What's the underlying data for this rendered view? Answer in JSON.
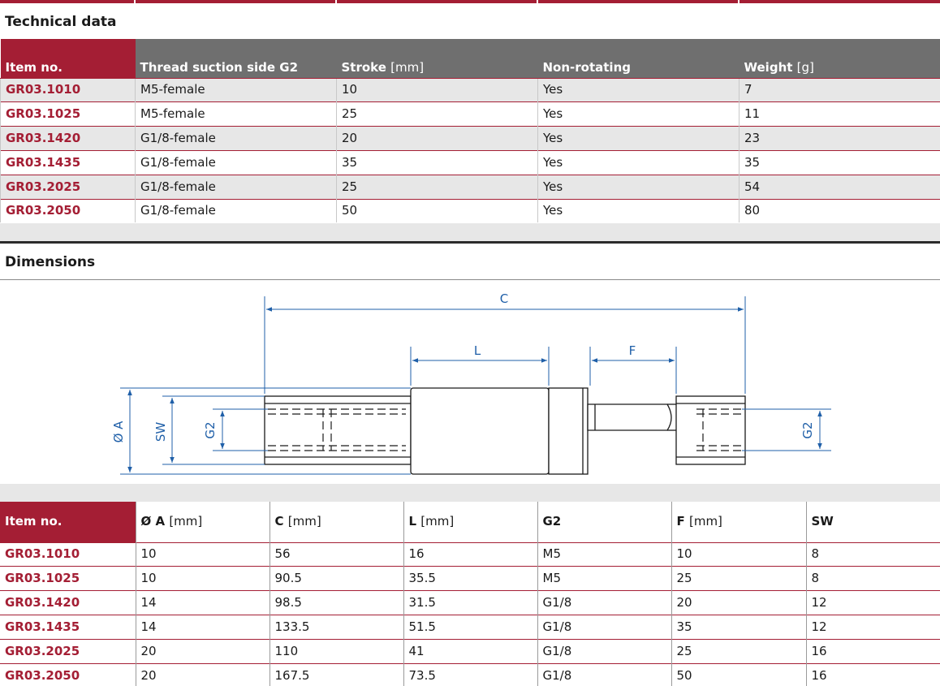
{
  "technical": {
    "title": "Technical data",
    "headers": [
      {
        "label": "Item no.",
        "unit": ""
      },
      {
        "label": "Thread suction side G2",
        "unit": ""
      },
      {
        "label": "Stroke",
        "unit": "[mm]"
      },
      {
        "label": "Non-rotating",
        "unit": ""
      },
      {
        "label": "Weight",
        "unit": "[g]"
      }
    ],
    "rows": [
      [
        "GR03.1010",
        "M5-female",
        "10",
        "Yes",
        "7"
      ],
      [
        "GR03.1025",
        "M5-female",
        "25",
        "Yes",
        "11"
      ],
      [
        "GR03.1420",
        "G1/8-female",
        "20",
        "Yes",
        "23"
      ],
      [
        "GR03.1435",
        "G1/8-female",
        "35",
        "Yes",
        "35"
      ],
      [
        "GR03.2025",
        "G1/8-female",
        "25",
        "Yes",
        "54"
      ],
      [
        "GR03.2050",
        "G1/8-female",
        "50",
        "Yes",
        "80"
      ]
    ]
  },
  "dimensions": {
    "title": "Dimensions",
    "drawing_labels": {
      "c": "C",
      "l": "L",
      "f": "F",
      "a": "Ø A",
      "sw": "SW",
      "g2_left": "G2",
      "g2_right": "G2"
    },
    "headers": [
      {
        "label": "Item no.",
        "unit": ""
      },
      {
        "label": "Ø A",
        "unit": "[mm]"
      },
      {
        "label": "C",
        "unit": "[mm]"
      },
      {
        "label": "L",
        "unit": "[mm]"
      },
      {
        "label": "G2",
        "unit": ""
      },
      {
        "label": "F",
        "unit": "[mm]"
      },
      {
        "label": "SW",
        "unit": ""
      }
    ],
    "rows": [
      [
        "GR03.1010",
        "10",
        "56",
        "16",
        "M5",
        "10",
        "8"
      ],
      [
        "GR03.1025",
        "10",
        "90.5",
        "35.5",
        "M5",
        "25",
        "8"
      ],
      [
        "GR03.1420",
        "14",
        "98.5",
        "31.5",
        "G1/8",
        "20",
        "12"
      ],
      [
        "GR03.1435",
        "14",
        "133.5",
        "51.5",
        "G1/8",
        "35",
        "12"
      ],
      [
        "GR03.2025",
        "20",
        "110",
        "41",
        "G1/8",
        "25",
        "16"
      ],
      [
        "GR03.2050",
        "20",
        "167.5",
        "73.5",
        "G1/8",
        "50",
        "16"
      ]
    ]
  },
  "colors": {
    "brand_red": "#a41e34",
    "header_grey": "#6f6f6f",
    "row_grey": "#e7e7e7",
    "dimension_blue": "#1f5fa8"
  }
}
